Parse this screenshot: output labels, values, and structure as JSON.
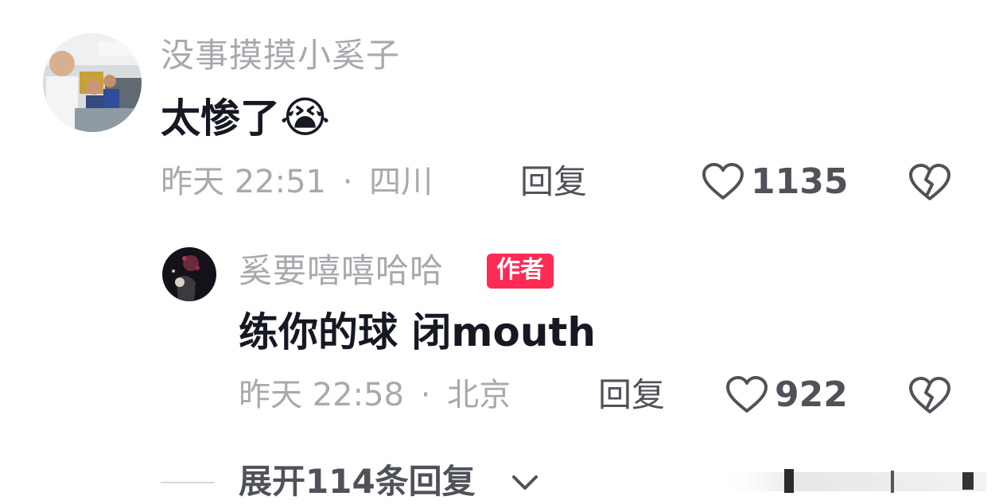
{
  "comments": [
    {
      "username": "没事摸摸小奚子",
      "content": "太惨了",
      "emoji": "😭",
      "time": "昨天 22:51",
      "separator": "·",
      "location": "四川",
      "reply_label": "回复",
      "likes": "1135",
      "like_icon": "heart-outline-icon",
      "dislike_icon": "broken-heart-icon"
    },
    {
      "username": "奚要嘻嘻哈哈",
      "badge": "作者",
      "content": "练你的球 闭mouth",
      "time": "昨天 22:58",
      "separator": "·",
      "location": "北京",
      "reply_label": "回复",
      "likes": "922",
      "like_icon": "heart-outline-icon",
      "dislike_icon": "broken-heart-icon"
    }
  ],
  "expand_replies": {
    "label": "展开114条回复",
    "icon": "chevron-down-icon"
  },
  "colors": {
    "primary_text": "#161823",
    "secondary_text": "#a8a9ae",
    "action_text": "#505259",
    "badge_bg": "#fe2c55"
  }
}
